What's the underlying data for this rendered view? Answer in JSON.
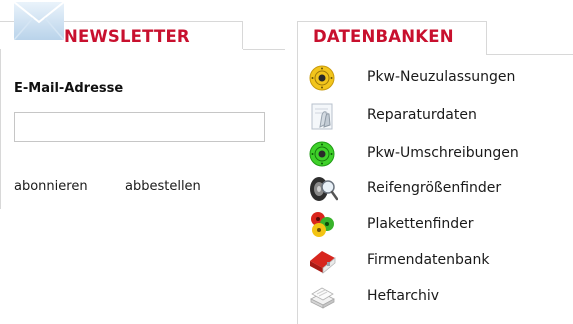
{
  "newsletter": {
    "title": "NEWSLETTER",
    "email_label": "E-Mail-Adresse",
    "email_value": "",
    "subscribe_label": "abonnieren",
    "unsubscribe_label": "abbestellen"
  },
  "databases": {
    "title": "DATENBANKEN",
    "items": [
      {
        "label": "Pkw-Neuzulassungen",
        "icon": "yellow-inspection-sticker-icon"
      },
      {
        "label": "Reparaturdaten",
        "icon": "repair-document-icon"
      },
      {
        "label": "Pkw-Umschreibungen",
        "icon": "green-inspection-sticker-icon"
      },
      {
        "label": "Reifengrößenfinder",
        "icon": "tire-magnifier-icon"
      },
      {
        "label": "Plakettenfinder",
        "icon": "emission-stickers-icon"
      },
      {
        "label": "Firmendatenbank",
        "icon": "company-building-icon"
      },
      {
        "label": "Heftarchiv",
        "icon": "magazine-archive-icon"
      }
    ]
  },
  "colors": {
    "accent": "#c8102e",
    "border": "#d8d8d8"
  }
}
